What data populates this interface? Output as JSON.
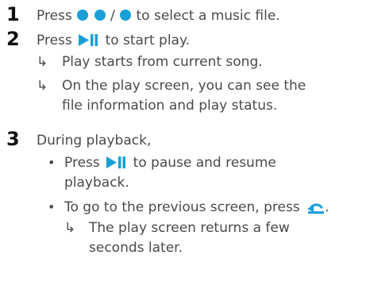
{
  "accent_color": "#1a9fd8",
  "steps": [
    {
      "number": "1",
      "pre": "Press",
      "sep": "/",
      "post": "to select a music file."
    },
    {
      "number": "2",
      "pre": "Press",
      "post": "to start play.",
      "results": [
        "Play starts from current song.",
        "On the play screen, you can see the",
        "file information and play status."
      ]
    },
    {
      "number": "3",
      "intro": "During playback,",
      "bullets": [
        {
          "bullet": "•",
          "pre": "Press",
          "post": "to pause and resume",
          "cont": "playback."
        },
        {
          "bullet": "•",
          "text": "To go to the previous screen, press",
          "end": ".",
          "results": [
            "The play screen returns a few",
            "seconds later."
          ]
        }
      ]
    }
  ]
}
